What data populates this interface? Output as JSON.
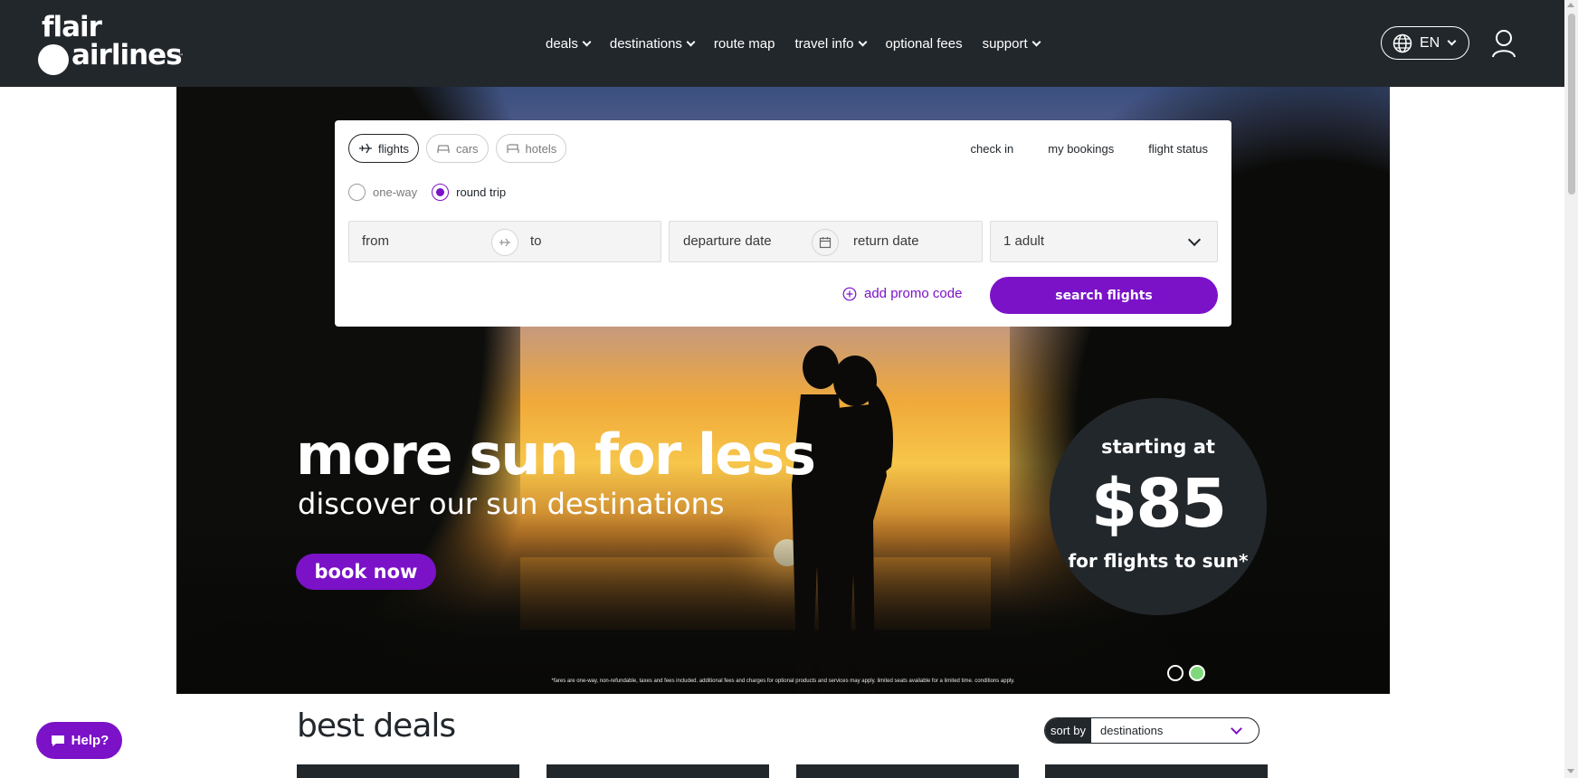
{
  "brand": {
    "line1": "flair",
    "line2": "airlines",
    "tm": "™"
  },
  "nav": {
    "items": [
      {
        "label": "deals",
        "dropdown": true
      },
      {
        "label": "destinations",
        "dropdown": true
      },
      {
        "label": "route map",
        "dropdown": false
      },
      {
        "label": "travel info",
        "dropdown": true
      },
      {
        "label": "optional fees",
        "dropdown": false
      },
      {
        "label": "support",
        "dropdown": true
      }
    ],
    "language": "EN"
  },
  "search": {
    "tabs": [
      "flights",
      "cars",
      "hotels"
    ],
    "active_tab": "flights",
    "links": [
      "check in",
      "my bookings",
      "flight status"
    ],
    "trip_types": [
      "one-way",
      "round trip"
    ],
    "selected_trip": "round trip",
    "from_placeholder": "from",
    "to_placeholder": "to",
    "departure_placeholder": "departure date",
    "return_placeholder": "return date",
    "passengers": "1 adult",
    "promo_label": "add promo code",
    "search_label": "search flights"
  },
  "hero": {
    "headline": "more sun for less",
    "subhead": "discover our sun destinations",
    "cta": "book now",
    "badge_top": "starting at",
    "badge_price": "$85",
    "badge_bottom": "for flights to sun*",
    "disclaimer": "*fares are one-way, non-refundable, taxes and fees included. additional fees and charges for optional products and services may apply. limited seats available for a limited time. conditions apply.",
    "slides": 2,
    "active_slide": 2
  },
  "deals": {
    "title": "best deals",
    "sort_label": "sort by",
    "sort_value": "destinations"
  },
  "help": {
    "label": "Help?"
  },
  "colors": {
    "nav_bg": "#22272c",
    "accent": "#7b12c8",
    "slide_active": "#7fd97a"
  }
}
